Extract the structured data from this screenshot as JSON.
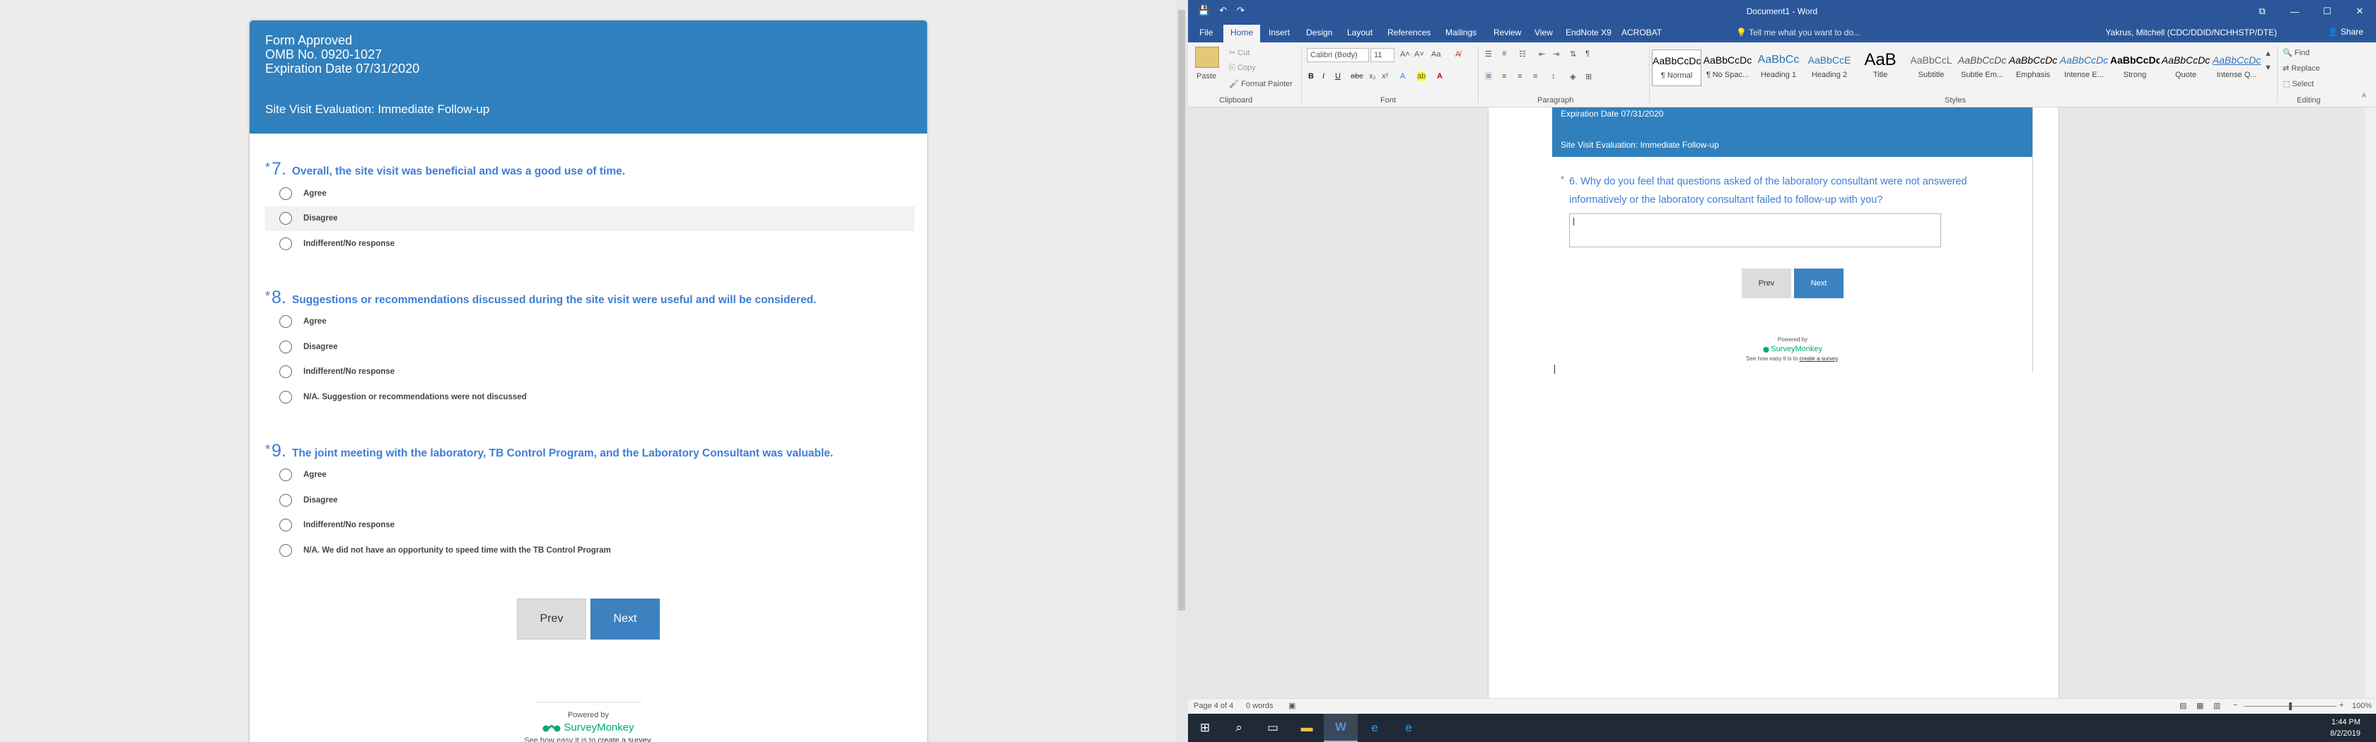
{
  "survey": {
    "header": {
      "line1": "Form Approved",
      "line2": "OMB No. 0920-1027",
      "line3": "Expiration Date 07/31/2020",
      "title": "Site Visit Evaluation: Immediate Follow-up"
    },
    "questions": [
      {
        "star": "*",
        "num": "7.",
        "text": "Overall, the site visit was beneficial and was a good use of time.",
        "options": [
          "Agree",
          "Disagree",
          "Indifferent/No response"
        ]
      },
      {
        "star": "*",
        "num": "8.",
        "text": "Suggestions or recommendations discussed during the site visit were useful and will be considered.",
        "options": [
          "Agree",
          "Disagree",
          "Indifferent/No response",
          "N/A. Suggestion or recommendations were not discussed"
        ]
      },
      {
        "star": "*",
        "num": "9.",
        "text": "The joint meeting with the laboratory, TB Control Program, and the Laboratory Consultant was valuable.",
        "options": [
          "Agree",
          "Disagree",
          "Indifferent/No response",
          "N/A. We did not have an opportunity to speed time with the TB Control Program"
        ]
      }
    ],
    "prev_label": "Prev",
    "next_label": "Next",
    "powered_by": "Powered by",
    "brand": "SurveyMonkey",
    "tagline_prefix": "See how easy it is to ",
    "tagline_link": "create a survey",
    "tagline_suffix": "."
  },
  "word": {
    "window_title": "Document1 - Word",
    "qat": [
      "💾",
      "↶",
      "↷"
    ],
    "window_controls": [
      "⧉",
      "—",
      "☐",
      "✕"
    ],
    "tabs": [
      "File",
      "Home",
      "Insert",
      "Design",
      "Layout",
      "References",
      "Mailings",
      "Review",
      "View",
      "EndNote X9",
      "ACROBAT"
    ],
    "active_tab": "Home",
    "tell_me": "Tell me what you want to do...",
    "user": "Yakrus, Mitchell (CDC/DDID/NCHHSTP/DTE)",
    "share": "Share",
    "clipboard": {
      "paste": "Paste",
      "cut": "Cut",
      "copy": "Copy",
      "format_painter": "Format Painter",
      "label": "Clipboard"
    },
    "font": {
      "name": "Calibri (Body)",
      "size": "11",
      "label": "Font"
    },
    "paragraph": {
      "label": "Paragraph"
    },
    "styles": {
      "label": "Styles",
      "items": [
        {
          "preview": "AaBbCcDc",
          "name": "¶ Normal"
        },
        {
          "preview": "AaBbCcDc",
          "name": "¶ No Spac..."
        },
        {
          "preview": "AaBbCc",
          "name": "Heading 1"
        },
        {
          "preview": "AaBbCcE",
          "name": "Heading 2"
        },
        {
          "preview": "AaB",
          "name": "Title"
        },
        {
          "preview": "AaBbCcL",
          "name": "Subtitle"
        },
        {
          "preview": "AaBbCcDc",
          "name": "Subtle Em..."
        },
        {
          "preview": "AaBbCcDc",
          "name": "Emphasis"
        },
        {
          "preview": "AaBbCcDc",
          "name": "Intense E..."
        },
        {
          "preview": "AaBbCcDc",
          "name": "Strong"
        },
        {
          "preview": "AaBbCcDc",
          "name": "Quote"
        },
        {
          "preview": "AaBbCcDc",
          "name": "Intense Q..."
        }
      ]
    },
    "editing": {
      "find": "Find",
      "replace": "Replace",
      "select": "Select",
      "label": "Editing"
    },
    "document": {
      "exp_date": "Expiration Date 07/31/2020",
      "title": "Site Visit Evaluation: Immediate Follow-up",
      "q_star": "*",
      "question": "6. Why do you feel that questions asked of the laboratory consultant were not answered informatively or the laboratory consultant failed to follow-up with you?",
      "prev_label": "Prev",
      "next_label": "Next",
      "powered_by": "Powered by",
      "brand": "SurveyMonkey",
      "tagline_prefix": "See how easy it is to ",
      "tagline_link": "create a survey",
      "tagline_suffix": "."
    },
    "status": {
      "page": "Page 4 of 4",
      "words": "0 words",
      "zoom": "100%"
    }
  },
  "taskbar": {
    "time": "1:44 PM",
    "date": "8/2/2019"
  }
}
